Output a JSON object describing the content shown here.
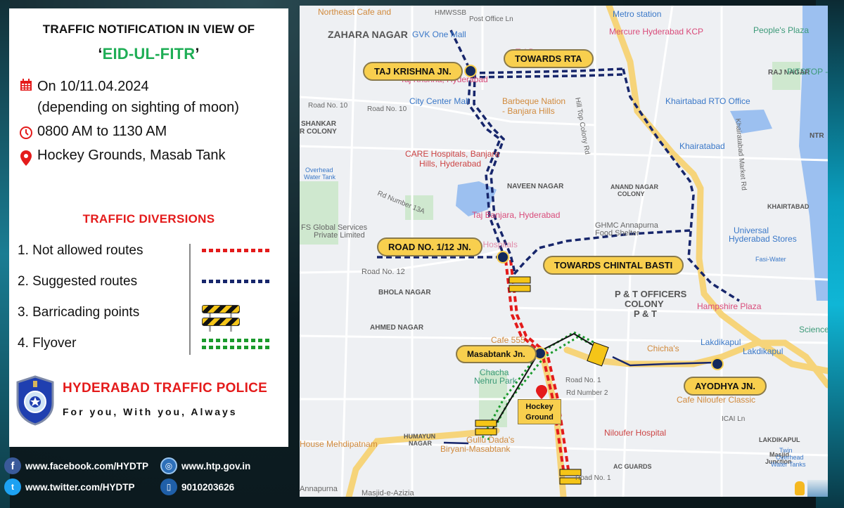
{
  "notification": {
    "title_line1": "TRAFFIC NOTIFICATION IN VIEW OF",
    "title_quote_open": "‘",
    "title_event": "EID-UL-FITR",
    "title_quote_close": "’",
    "date": "On 10/11.04.2024",
    "date_note": "(depending on sighting of moon)",
    "time": "0800 AM to 1130 AM",
    "venue": "Hockey Grounds, Masab Tank",
    "icons": {
      "date": "calendar-icon",
      "time": "clock-icon",
      "venue": "location-pin-icon"
    },
    "accent_color": "#e41b1b",
    "event_color": "#1fae56"
  },
  "diversions": {
    "title": "TRAFFIC DIVERSIONS",
    "items": [
      {
        "label": "1. Not allowed routes",
        "swatch": "red-dotted-line",
        "color": "#e31b1b"
      },
      {
        "label": "2. Suggested routes",
        "swatch": "blue-dotted-line",
        "color": "#17266b"
      },
      {
        "label": "3. Barricading points",
        "swatch": "barricade-icon",
        "color": "#f5c518"
      },
      {
        "label": "4. Flyover",
        "swatch": "green-double-dotted-line",
        "color": "#1a9a2c"
      }
    ]
  },
  "branding": {
    "name": "HYDERABAD TRAFFIC POLICE",
    "tagline": "For you, With you, Always",
    "logo": "traffic-police-badge"
  },
  "contacts": {
    "facebook": "www.facebook.com/HYDTP",
    "website": "www.htp.gov.in",
    "twitter": "www.twitter.com/HYDTP",
    "phone": "9010203626",
    "icons": {
      "facebook": "f",
      "website": "◎",
      "twitter": "t",
      "phone": "▯"
    }
  },
  "map": {
    "junctions": {
      "taj_krishna": "TAJ KRISHNA JN.",
      "towards_rta": "TOWARDS RTA",
      "road_1_12": "ROAD NO. 1/12 JN.",
      "towards_chintal_basti": "TOWARDS CHINTAL BASTI",
      "masabtank": "Masabtank Jn.",
      "ayodhya": "AYODHYA JN.",
      "hockey_ground_line1": "Hockey",
      "hockey_ground_line2": "Ground"
    },
    "places": {
      "northeast_cafe": "Northeast Cafe and",
      "hmwssb": "HMWSSB",
      "post_office_ln": "Post Office Ln",
      "metro_station": "Metro station",
      "zahara_nagar": "ZAHARA NAGAR",
      "gvk_one_mall": "GVK One Mall",
      "mercure": "Mercure Hyderabad KCP",
      "peoples_plaza": "People's Plaza",
      "raj_nagar": "RAJ NAGAR",
      "pitstop": "PITSTOP - G",
      "taj_deccan": "Taj Deccan",
      "taj_krishna_hotel": "Taj Krishna, Hyderabad",
      "road_no_10a": "Road No. 10",
      "road_no_10b": "Road No. 10",
      "city_center_mall": "City Center Mall",
      "barbeque_nation": "Barbeque Nation",
      "barbeque_nation2": "- Banjara Hills",
      "shankar_colony": "SHANKAR",
      "shankar_colony2": "R COLONY",
      "khairtabad_rto": "Khairtabad RTO Office",
      "hill_top_colony": "Hill Top Colony Rd",
      "khairatabad_market": "Khairatabad Market Rd",
      "ntr": "NTR",
      "care_hospitals": "CARE Hospitals, Banjara",
      "care_hospitals2": "Hills, Hyderabad",
      "khairatabad_metro": "Khairatabad",
      "overhead_water_tank": "Overhead",
      "overhead_water_tank2": "Water Tank",
      "naveen_nagar": "NAVEEN NAGAR",
      "anand_nagar": "ANAND NAGAR",
      "anand_nagar2": "COLONY",
      "khairtabad_area": "KHAIRTABAD",
      "rd_number_13a": "Rd Number 13A",
      "taj_banjara": "Taj Banjara, Hyderabad",
      "ghmc": "GHMC Annapurna",
      "ghmc2": "Food Shelter",
      "universal_stores": "Universal",
      "universal_stores2": "Hyderabad Stores",
      "fs_global": "FS Global Services",
      "fs_global2": "Private Limited",
      "virinchi": "Virinchi Hospitals",
      "fasi_water": "Fasi-Water",
      "road_no_12": "Road No. 12",
      "bhola_nagar": "BHOLA NAGAR",
      "pt_officers": "P & T OFFICERS",
      "pt_officers2": "COLONY",
      "pt_officers3": "P & T",
      "hampshire": "Hampshire Plaza",
      "ahmed_nagar": "AHMED NAGAR",
      "science": "Science",
      "lakdikapul": "Lakdikapul",
      "lakdikapul_metro": "Lakdikapul",
      "cafe_555": "Cafe 555 -",
      "chichas": "Chicha's",
      "chacha_nehru_park": "Chacha",
      "chacha_nehru_park2": "Nehru Park",
      "road_no_1": "Road No. 1",
      "rd_number_2": "Rd Number 2",
      "cafe_niloufer": "Cafe Niloufer Classic",
      "icai_ln": "ICAI Ln",
      "humayun_nagar": "HUMAYUN",
      "humayun_nagar2": "NAGAR",
      "niloufer_hospital": "Niloufer Hospital",
      "lakdikapul_area": "LAKDIKAPUL",
      "masjid_junction": "Masjid",
      "masjid_junction2": "Junction",
      "twin_tanks": "Twin",
      "twin_tanks2": "Overhead",
      "twin_tanks3": "Water Tanks",
      "house_mehdipatnam": "House Mehdipatnam",
      "gullu_dadas": "Gullu Dada's",
      "gullu_dadas2": "Biryani-Masabtank",
      "ac_guards": "AC GUARDS",
      "road_no_1b": "Road No. 1",
      "annapurna": "Annapurna",
      "masjid_e_azizia": "Masjid-e-Azizia"
    },
    "route_colors": {
      "not_allowed": "#e31b1b",
      "suggested": "#17266b",
      "flyover": "#1a9a2c",
      "major_road": "#f6d47a",
      "water": "#9cc0f0",
      "park": "#c8e6c9"
    }
  }
}
